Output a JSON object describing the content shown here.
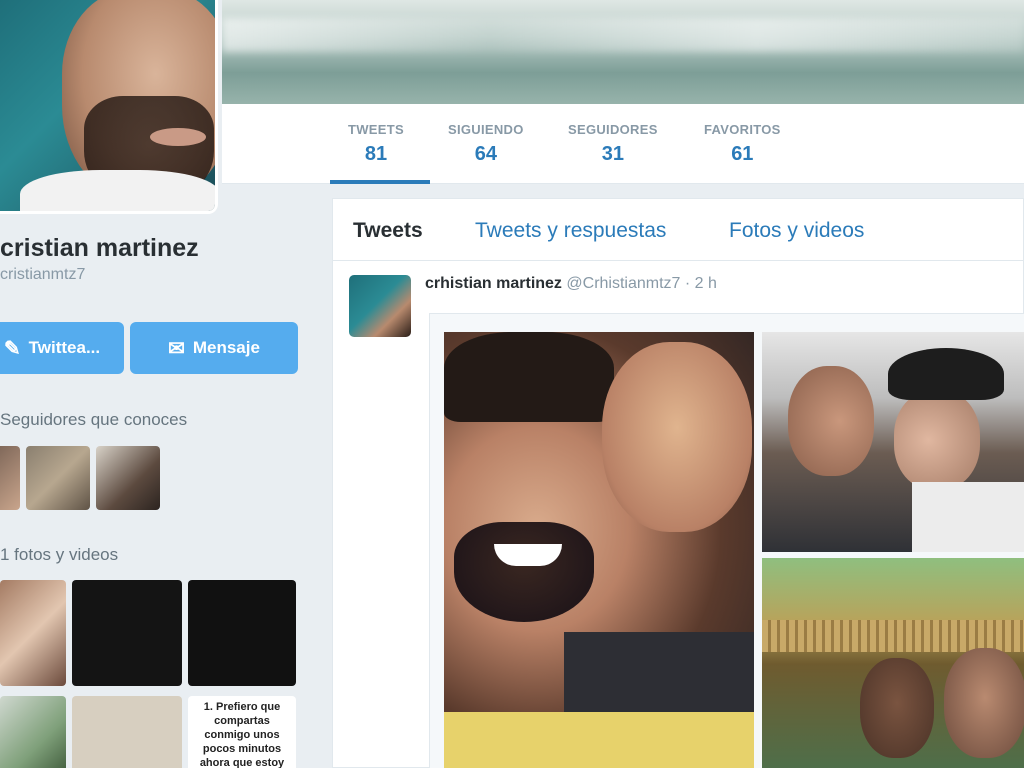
{
  "profile": {
    "name": "cristian martinez",
    "handle": "cristianmtz7"
  },
  "stats": [
    {
      "label": "TWEETS",
      "value": "81"
    },
    {
      "label": "SIGUIENDO",
      "value": "64"
    },
    {
      "label": "SEGUIDORES",
      "value": "31"
    },
    {
      "label": "FAVORITOS",
      "value": "61"
    }
  ],
  "buttons": {
    "tweet_label": "Twittea...",
    "message_label": "Mensaje"
  },
  "sidebar": {
    "known_followers_title": "Seguidores que conoces",
    "media_title": "1 fotos y videos",
    "media_text_3": "1. Prefiero que compartas conmigo unos pocos minutos ahora que estoy"
  },
  "tabs": [
    {
      "label": "Tweets"
    },
    {
      "label": "Tweets y respuestas"
    },
    {
      "label": "Fotos y videos"
    }
  ],
  "tweet": {
    "name": "crhistian martinez",
    "handle": "@Crhistianmtz7",
    "time": "· 2 h"
  },
  "colors": {
    "accent": "#2b7bb9",
    "button": "#55acee",
    "muted": "#8899a6"
  }
}
